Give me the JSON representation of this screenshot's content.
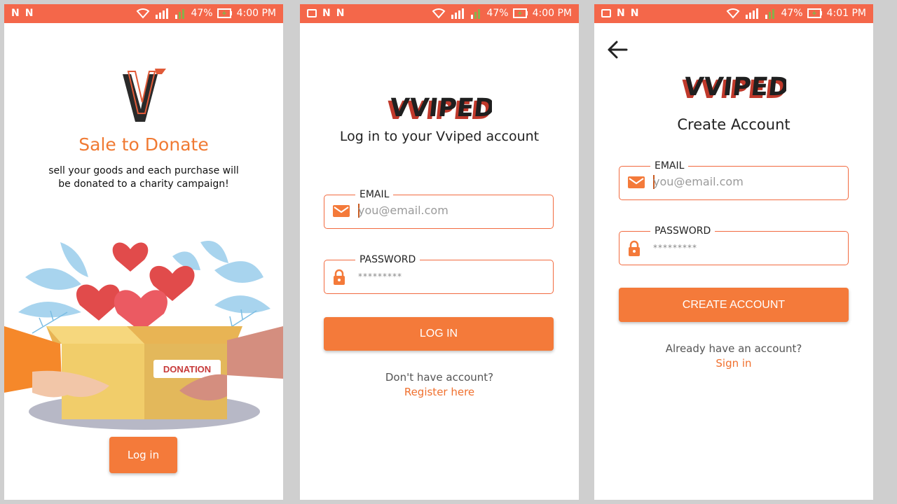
{
  "status_bar": [
    {
      "icons": [
        "notification-icon",
        "notification-icon"
      ],
      "battery": "47%",
      "time": "4:00 PM"
    },
    {
      "icons": [
        "image-icon",
        "notification-icon",
        "notification-icon"
      ],
      "battery": "47%",
      "time": "4:00 PM"
    },
    {
      "icons": [
        "image-icon",
        "notification-icon",
        "notification-icon"
      ],
      "battery": "47%",
      "time": "4:01 PM"
    }
  ],
  "onboarding": {
    "title": "Sale to Donate",
    "description_line1": "sell your goods and each purchase will",
    "description_line2": "be donated to a charity campaign!",
    "illustration_label": "DONATION",
    "login_button": "Log in"
  },
  "login": {
    "logo_text": "VVIPED",
    "heading": "Log in to your Vviped account",
    "email_label": "EMAIL",
    "email_placeholder": "you@email.com",
    "password_label": "PASSWORD",
    "password_placeholder": "*********",
    "submit_button": "LOG IN",
    "no_account_text": "Don't have account?",
    "register_link": "Register here"
  },
  "register": {
    "logo_text": "VVIPED",
    "heading": "Create Account",
    "email_label": "EMAIL",
    "email_placeholder": "you@email.com",
    "password_label": "PASSWORD",
    "password_placeholder": "*********",
    "submit_button": "CREATE ACCOUNT",
    "have_account_text": "Already have an account?",
    "signin_link": "Sign in"
  },
  "colors": {
    "accent": "#f47a3a",
    "status_bar": "#f4674a",
    "title_orange": "#f07a33",
    "logo_red": "#c0392b"
  }
}
